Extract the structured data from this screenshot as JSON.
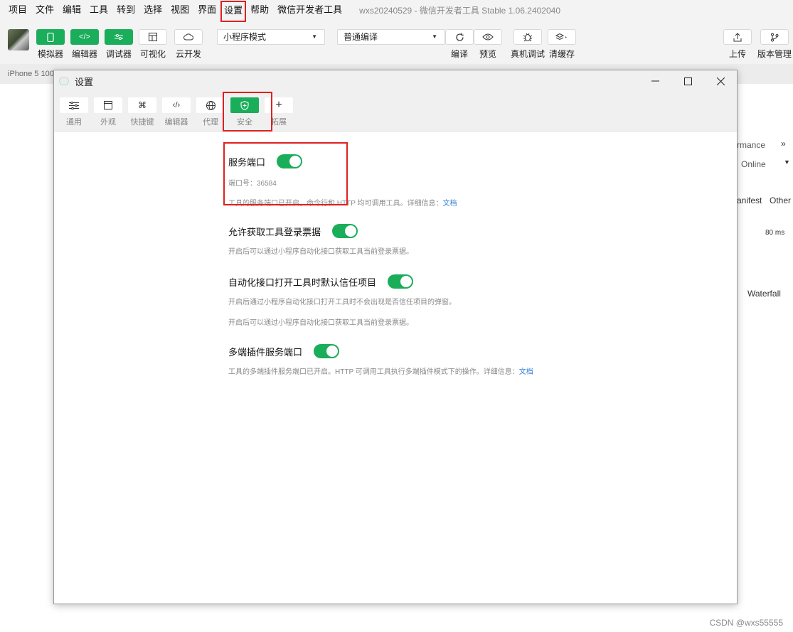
{
  "menubar": {
    "items": [
      "项目",
      "文件",
      "编辑",
      "工具",
      "转到",
      "选择",
      "视图",
      "界面",
      "设置",
      "帮助",
      "微信开发者工具"
    ],
    "app_title": "wxs20240529 - 微信开发者工具 Stable 1.06.2402040"
  },
  "toolbar": {
    "simulator": "模拟器",
    "editor": "编辑器",
    "debugger": "调试器",
    "visual": "可视化",
    "cloud": "云开发",
    "mode_select": "小程序模式",
    "compile_select": "普通编译",
    "compile": "编译",
    "preview": "预览",
    "remote_debug": "真机调试",
    "clear_cache": "清缓存",
    "upload": "上传",
    "version": "版本管理"
  },
  "background": {
    "sim_label": "iPhone 5 100",
    "right_texts": [
      "rmance",
      "Online",
      "anifest",
      "Other",
      "80 ms",
      "Waterfall"
    ]
  },
  "dialog": {
    "title": "设置",
    "tabs": [
      "通用",
      "外观",
      "快捷键",
      "编辑器",
      "代理",
      "安全",
      "拓展"
    ],
    "active_tab": "安全",
    "settings": [
      {
        "title": "服务端口",
        "port": "端口号：36584",
        "desc": "工具的服务端口已开启，命令行和 HTTP 均可调用工具。详细信息：",
        "link": "文档"
      },
      {
        "title": "允许获取工具登录票据",
        "desc": "开启后可以通过小程序自动化接口获取工具当前登录票据。"
      },
      {
        "title": "自动化接口打开工具时默认信任项目",
        "desc": "开启后通过小程序自动化接口打开工具时不会出现是否信任项目的弹窗。",
        "desc2": "开启后可以通过小程序自动化接口获取工具当前登录票据。"
      },
      {
        "title": "多端插件服务端口",
        "desc": "工具的多端插件服务端口已开启。HTTP 可调用工具执行多端插件模式下的操作。详细信息：",
        "link": "文档"
      }
    ]
  },
  "watermark": "CSDN @wxs55555",
  "colors": {
    "accent": "#1aad5a",
    "highlight": "#e02020",
    "link": "#2f7fd6"
  }
}
